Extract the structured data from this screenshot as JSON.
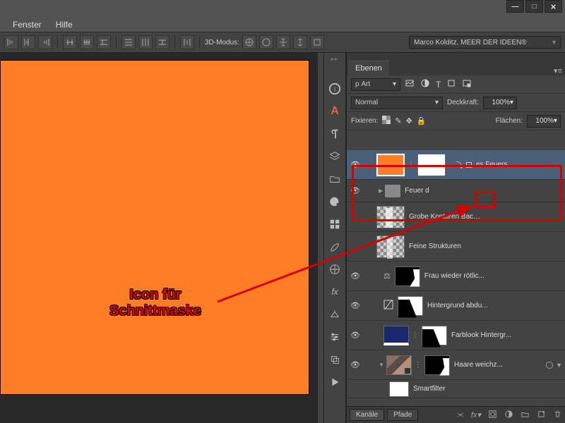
{
  "menu": {
    "fenster": "Fenster",
    "hilfe": "Hilfe"
  },
  "toolbar": {
    "mode3d": "3D-Modus:",
    "user": "Marco Kolditz, MEER DER IDEEN®"
  },
  "panel": {
    "tab": "Ebenen",
    "filter_label": "Art",
    "blend": "Normal",
    "opacity_label": "Deckkraft:",
    "opacity_value": "100%",
    "lock_label": "Fixieren:",
    "fill_label": "Flächen:",
    "fill_value": "100%"
  },
  "layers": {
    "l1": "es Feuers",
    "l2": "Feuer d",
    "l3": "Grobe Konturen Backup",
    "l4": "Feine Strukturen",
    "l5": "Frau wieder rötlic...",
    "l6": "Hintergrund abdu...",
    "l7": "Farblook Hintergr...",
    "l8": "Haare weichz...",
    "smart": "Smartfilter"
  },
  "bottom_tabs": {
    "kanal": "Kanäle",
    "pfade": "Pfade"
  },
  "annotation": {
    "line1": "Icon für",
    "line2": "Schnittmaske"
  }
}
